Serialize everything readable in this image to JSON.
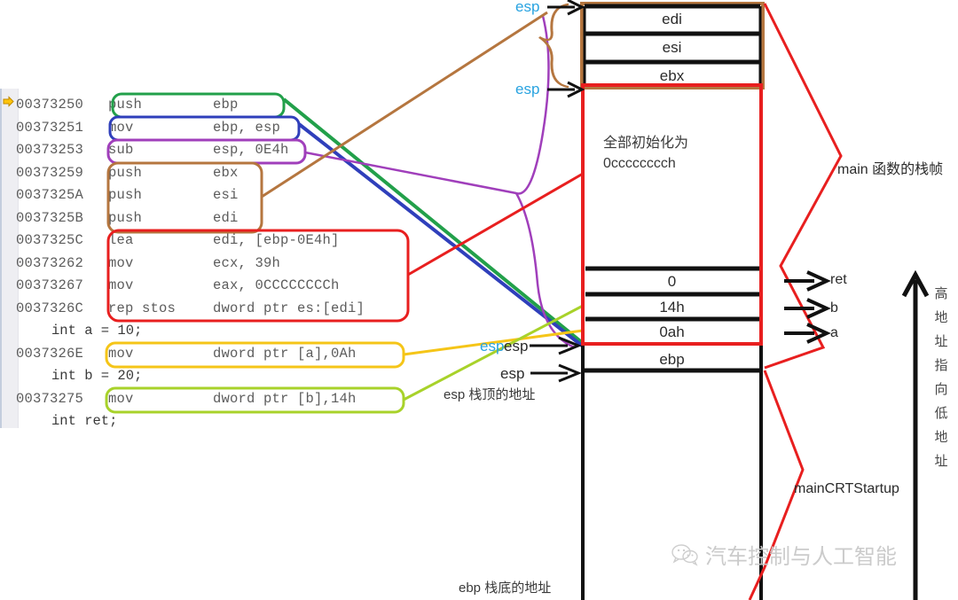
{
  "code": {
    "exec_marker_icon": "yellow-arrow-marker",
    "lines": [
      {
        "addr": "00373250",
        "mnem": "push",
        "ops": "ebp",
        "type": "asm"
      },
      {
        "addr": "00373251",
        "mnem": "mov",
        "ops": "ebp, esp",
        "type": "asm"
      },
      {
        "addr": "00373253",
        "mnem": "sub",
        "ops": "esp, 0E4h",
        "type": "asm"
      },
      {
        "addr": "00373259",
        "mnem": "push",
        "ops": "ebx",
        "type": "asm"
      },
      {
        "addr": "0037325A",
        "mnem": "push",
        "ops": "esi",
        "type": "asm"
      },
      {
        "addr": "0037325B",
        "mnem": "push",
        "ops": "edi",
        "type": "asm"
      },
      {
        "addr": "0037325C",
        "mnem": "lea",
        "ops": "edi, [ebp-0E4h]",
        "type": "asm"
      },
      {
        "addr": "00373262",
        "mnem": "mov",
        "ops": "ecx, 39h",
        "type": "asm"
      },
      {
        "addr": "00373267",
        "mnem": "mov",
        "ops": "eax, 0CCCCCCCCh",
        "type": "asm"
      },
      {
        "addr": "0037326C",
        "mnem": "rep stos",
        "ops": "dword ptr es:[edi]",
        "type": "asm"
      },
      {
        "addr": "",
        "mnem": "",
        "ops": "int a = 10;",
        "type": "src"
      },
      {
        "addr": "0037326E",
        "mnem": "mov",
        "ops": "dword ptr [a],0Ah",
        "type": "asm"
      },
      {
        "addr": "",
        "mnem": "",
        "ops": "int b = 20;",
        "type": "src"
      },
      {
        "addr": "00373275",
        "mnem": "mov",
        "ops": "dword ptr [b],14h",
        "type": "asm"
      },
      {
        "addr": "",
        "mnem": "",
        "ops": "int ret;",
        "type": "src"
      }
    ]
  },
  "highlights": [
    {
      "name": "push-ebp-box",
      "color": "#22a04a"
    },
    {
      "name": "mov-ebp-esp-box",
      "color": "#2f3fbb"
    },
    {
      "name": "sub-esp-box",
      "color": "#a03fbb"
    },
    {
      "name": "push-regs-box",
      "color": "#b5763f"
    },
    {
      "name": "rep-stos-box",
      "color": "#e81f1f"
    },
    {
      "name": "mov-a-box",
      "color": "#f5c518"
    },
    {
      "name": "mov-b-box",
      "color": "#a8d22a"
    }
  ],
  "stack": {
    "cells": [
      {
        "label": "edi",
        "name": "stack-cell-edi"
      },
      {
        "label": "esi",
        "name": "stack-cell-esi"
      },
      {
        "label": "ebx",
        "name": "stack-cell-ebx"
      },
      {
        "label": "",
        "name": "stack-cell-uninit"
      },
      {
        "label": "0",
        "name": "stack-cell-ret"
      },
      {
        "label": "14h",
        "name": "stack-cell-b"
      },
      {
        "label": "0ah",
        "name": "stack-cell-a"
      },
      {
        "label": "ebp",
        "name": "stack-cell-ebp"
      }
    ],
    "uninit_note_line1": "全部初始化为",
    "uninit_note_line2": "0cccccccch",
    "esp_top_label": "esp",
    "esp_mid_label": "esp",
    "esp_inline_cyan": "esp",
    "esp_inline_dark": "esp",
    "esp_bottom_arrow_label": "esp",
    "esp_bottom_desc": "esp 栈顶的地址",
    "ebp_bottom_desc": "ebp 栈底的地址",
    "border_brown": "#b5763f",
    "border_red": "#e81f1f",
    "border_black": "#111111"
  },
  "annotations": {
    "main_frame": "main 函数的栈帧",
    "ret_label": "ret",
    "b_label": "b",
    "a_label": "a",
    "crt_startup": "mainCRTStartup",
    "direction_chars": [
      "高",
      "地",
      "址",
      "指",
      "向",
      "低",
      "地",
      "址"
    ],
    "direction_arrow_icon": "up-arrow-icon"
  },
  "watermark": {
    "icon": "wechat-icon",
    "text": "汽车控制与人工智能"
  }
}
